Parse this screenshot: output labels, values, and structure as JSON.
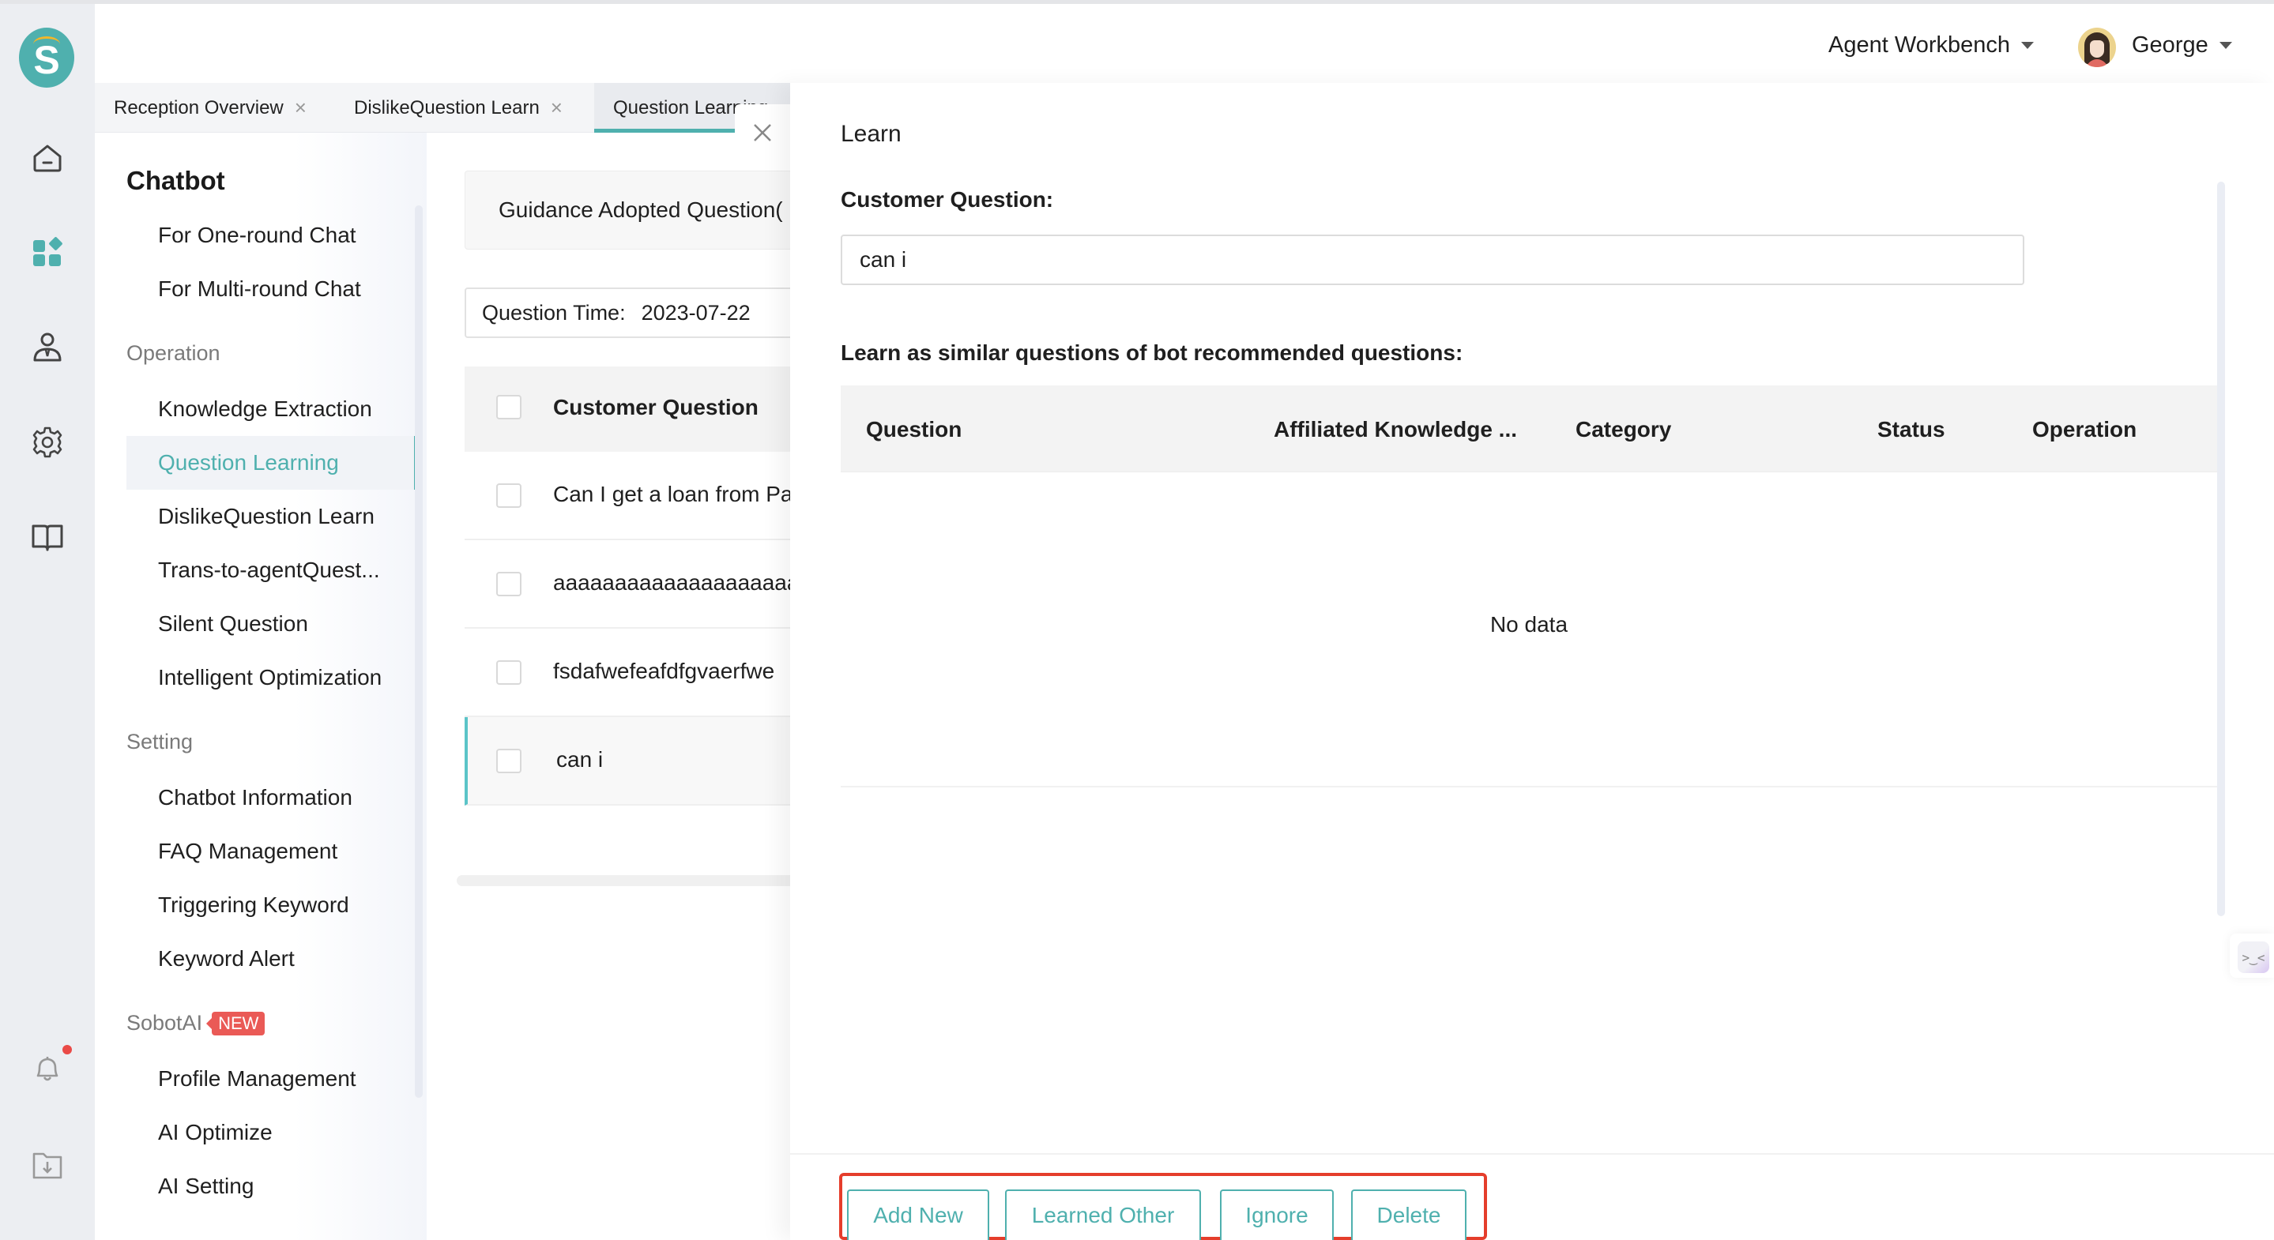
{
  "header": {
    "workbench_label": "Agent Workbench",
    "user_name": "George"
  },
  "rail": {
    "icons": [
      "home-icon",
      "apps-icon",
      "agent-icon",
      "settings-icon",
      "book-icon",
      "bell-icon",
      "download-folder-icon"
    ],
    "active_icon": "apps-icon",
    "notification_dot": true
  },
  "tabs": [
    {
      "label": "Reception Overview",
      "closable": true
    },
    {
      "label": "DislikeQuestion Learn",
      "closable": true
    },
    {
      "label": "Question Learning",
      "closable": true,
      "active": true
    }
  ],
  "subnav": {
    "title": "Chatbot",
    "top_items": [
      "For One-round Chat",
      "For Multi-round Chat"
    ],
    "groups": [
      {
        "label": "Operation",
        "items": [
          "Knowledge Extraction",
          "Question Learning",
          "DislikeQuestion Learn",
          "Trans-to-agentQuest...",
          "Silent Question",
          "Intelligent Optimization"
        ]
      },
      {
        "label": "Setting",
        "items": [
          "Chatbot Information",
          "FAQ Management",
          "Triggering Keyword",
          "Keyword Alert"
        ]
      },
      {
        "label": "SobotAI",
        "badge": "NEW",
        "items": [
          "Profile Management",
          "AI Optimize",
          "AI Setting"
        ]
      }
    ],
    "active_item": "Question Learning"
  },
  "middle": {
    "section_label": "Guidance Adopted Question(",
    "filter_label": "Question Time:",
    "filter_value": "2023-07-22",
    "table_header": "Customer Question",
    "rows": [
      "Can I get a loan from Pa",
      "aaaaaaaaaaaaaaaaaaaaaa",
      "fsdafwefeafdfgvaerfwe",
      "can i"
    ],
    "selected_row": "can i"
  },
  "drawer": {
    "title": "Learn",
    "customer_question_label": "Customer Question:",
    "customer_question_value": "can i",
    "similar_label": "Learn as similar questions of bot recommended questions:",
    "columns": [
      "Question",
      "Affiliated Knowledge ...",
      "Category",
      "Status",
      "Operation"
    ],
    "empty_text": "No data",
    "buttons": [
      "Add New",
      "Learned Other",
      "Ignore",
      "Delete"
    ],
    "accent_color": "#4fb0ae",
    "highlight_color": "#e53d2b"
  },
  "float_widget": {
    "glyph": ">‿<"
  }
}
